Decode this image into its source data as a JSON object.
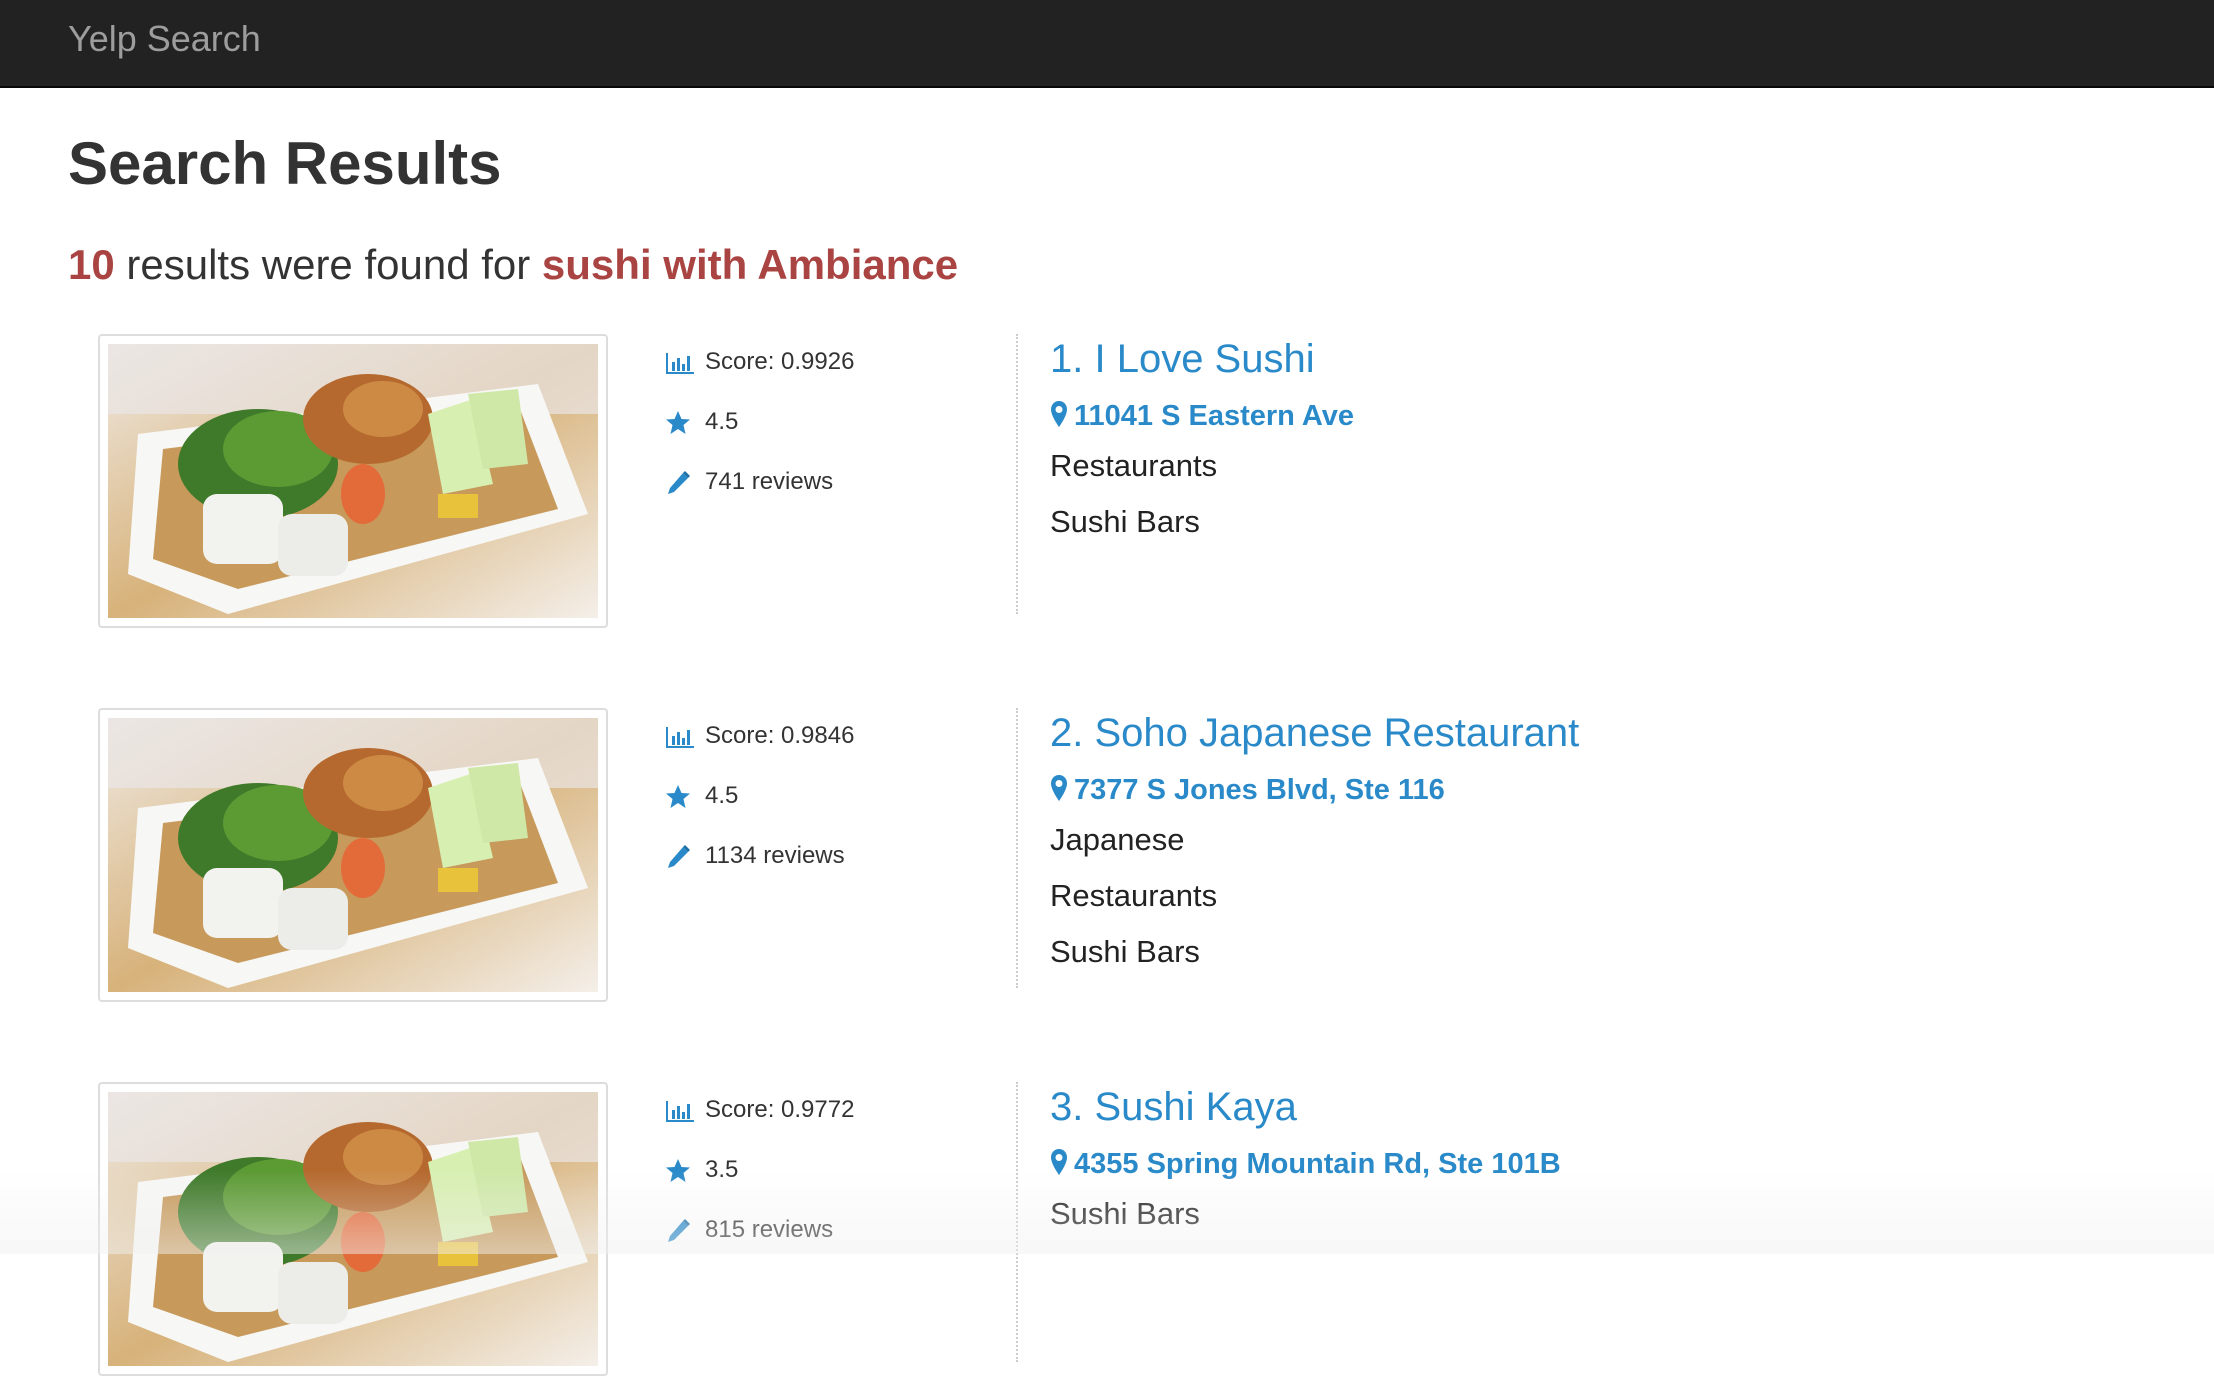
{
  "navbar": {
    "brand": "Yelp Search"
  },
  "page": {
    "title": "Search Results",
    "summary": {
      "count": "10",
      "middle_text": " results were found for ",
      "query": "sushi with Ambiance"
    }
  },
  "results": [
    {
      "score_label": "Score: 0.9926",
      "rating": "4.5",
      "reviews": "741 reviews",
      "name": "1. I Love Sushi",
      "address": "11041 S Eastern Ave",
      "categories": [
        "Restaurants",
        "Sushi Bars"
      ]
    },
    {
      "score_label": "Score: 0.9846",
      "rating": "4.5",
      "reviews": "1134 reviews",
      "name": "2. Soho Japanese Restaurant",
      "address": "7377 S Jones Blvd, Ste 116",
      "categories": [
        "Japanese",
        "Restaurants",
        "Sushi Bars"
      ]
    },
    {
      "score_label": "Score: 0.9772",
      "rating": "3.5",
      "reviews": "815 reviews",
      "name": "3. Sushi Kaya",
      "address": "4355 Spring Mountain Rd, Ste 101B",
      "categories": [
        "Sushi Bars"
      ]
    }
  ],
  "icons": {
    "score": "bar-chart-icon",
    "rating": "star-icon",
    "reviews": "pencil-icon",
    "address": "map-marker-icon"
  },
  "colors": {
    "navbar_bg": "#222222",
    "brand_text": "#9d9d9d",
    "highlight": "#a94442",
    "link": "#2a8ac9"
  }
}
